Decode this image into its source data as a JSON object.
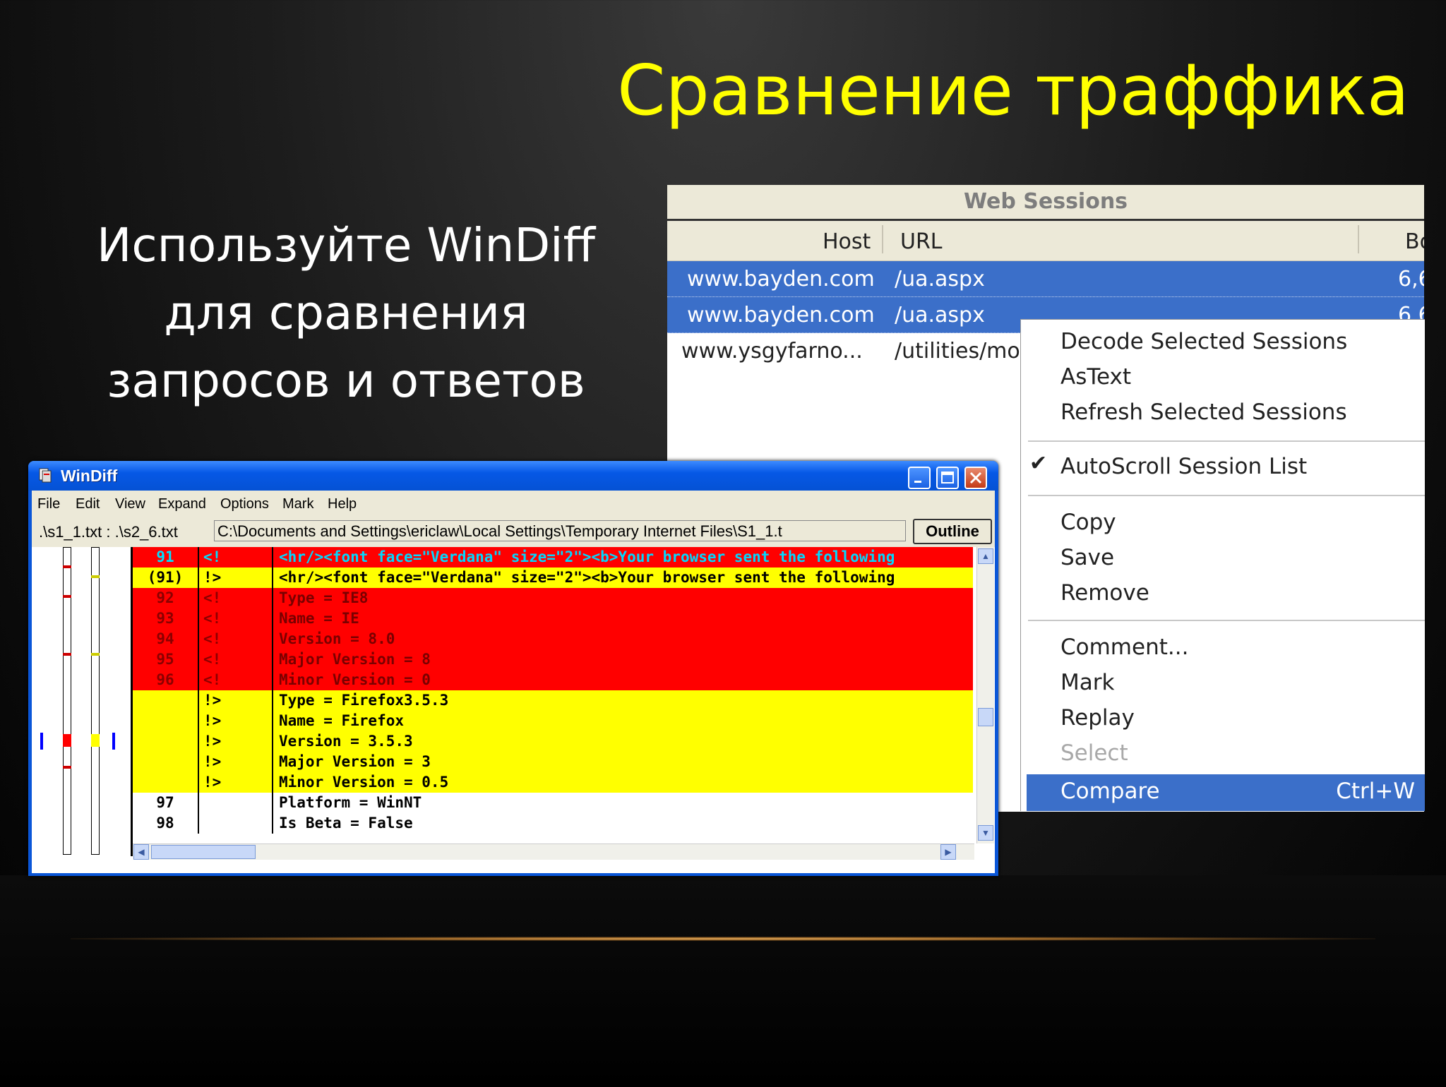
{
  "slide": {
    "title": "Сравнение траффика",
    "subtitle_lines": [
      "Используйте WinDiff",
      "для сравнения",
      "запросов и ответов"
    ]
  },
  "web_sessions": {
    "title": "Web Sessions",
    "columns": {
      "host": "Host",
      "url": "URL",
      "body": "Bo"
    },
    "rows": [
      {
        "host": "www.bayden.com",
        "url": "/ua.aspx",
        "body": "6,6"
      },
      {
        "host": "www.bayden.com",
        "url": "/ua.aspx",
        "body": "6,6"
      },
      {
        "host": "www.ysgyfarno...",
        "url": "/utilities/mou",
        "body": ""
      }
    ]
  },
  "context_menu": {
    "decode": "Decode Selected Sessions",
    "astext": "AsText",
    "refresh": "Refresh Selected Sessions",
    "autoscroll": "AutoScroll Session List",
    "copy": "Copy",
    "save": "Save",
    "remove": "Remove",
    "comment": "Comment...",
    "mark": "Mark",
    "replay": "Replay",
    "select": "Select",
    "compare": "Compare",
    "compare_shortcut": "Ctrl+W"
  },
  "windiff": {
    "title": "WinDiff",
    "menu": [
      "File",
      "Edit",
      "View",
      "Expand",
      "Options",
      "Mark",
      "Help"
    ],
    "files_label": ".\\s1_1.txt : .\\s2_6.txt",
    "path": "C:\\Documents and Settings\\ericlaw\\Local Settings\\Temporary Internet Files\\S1_1.t",
    "outline_button": "Outline",
    "lines": [
      {
        "num": "91",
        "mark": "<!",
        "text": "<hr/><font face=\"Verdana\" size=\"2\"><b>Your browser sent the following"
      },
      {
        "num": "(91)",
        "mark": "!>",
        "text": "<hr/><font face=\"Verdana\" size=\"2\"><b>Your browser sent the following"
      },
      {
        "num": "92",
        "mark": "<!",
        "text": "Type = IE8"
      },
      {
        "num": "93",
        "mark": "<!",
        "text": "Name = IE"
      },
      {
        "num": "94",
        "mark": "<!",
        "text": "Version = 8.0"
      },
      {
        "num": "95",
        "mark": "<!",
        "text": "Major Version = 8"
      },
      {
        "num": "96",
        "mark": "<!",
        "text": "Minor Version = 0"
      },
      {
        "num": "",
        "mark": "!>",
        "text": "Type = Firefox3.5.3"
      },
      {
        "num": "",
        "mark": "!>",
        "text": "Name = Firefox"
      },
      {
        "num": "",
        "mark": "!>",
        "text": "Version = 3.5.3"
      },
      {
        "num": "",
        "mark": "!>",
        "text": "Major Version = 3"
      },
      {
        "num": "",
        "mark": "!>",
        "text": "Minor Version = 0.5"
      },
      {
        "num": "97",
        "mark": "",
        "text": "Platform = WinNT"
      },
      {
        "num": "98",
        "mark": "",
        "text": "Is Beta = False"
      }
    ]
  },
  "colors": {
    "title": "#ffff00",
    "selection": "#3b6fc9",
    "diff_left": "#ff0000",
    "diff_right": "#ffff00"
  }
}
